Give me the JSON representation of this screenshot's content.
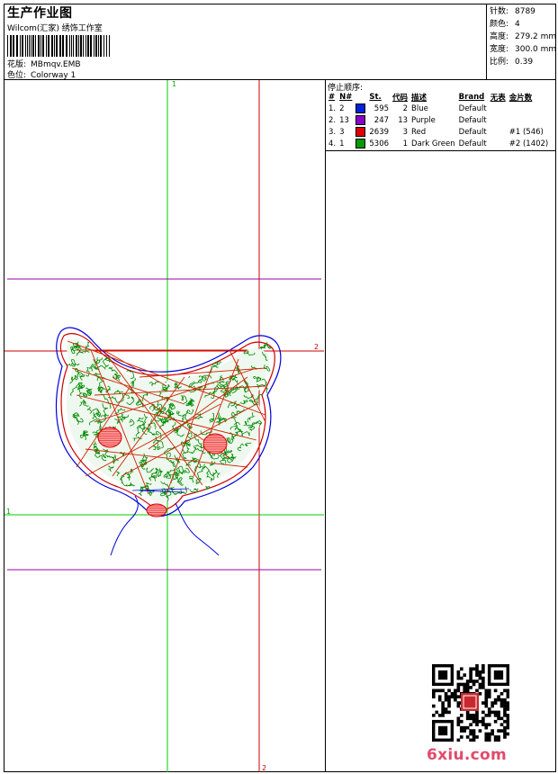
{
  "header": {
    "title": "生产作业图",
    "subtitle": "Wilcom(汇家) 绣饰工作室",
    "design_label": "花版:",
    "design_value": "MBmqv.EMB",
    "colorway_label": "色位:",
    "colorway_value": "Colorway 1"
  },
  "stats": [
    {
      "label": "针数:",
      "value": "8789"
    },
    {
      "label": "颜色:",
      "value": "4"
    },
    {
      "label": "高度:",
      "value": "279.2 mm"
    },
    {
      "label": "宽度:",
      "value": "300.0 mm"
    },
    {
      "label": "比例:",
      "value": "0.39"
    }
  ],
  "stop_sequence": {
    "title": "停止顺序:",
    "columns": [
      "#",
      "N#",
      "St.",
      "代码",
      "描述",
      "Brand",
      "无表",
      "金片数"
    ],
    "rows": [
      {
        "index": "1.",
        "n": "2",
        "color": "#0022dd",
        "stitches": "595",
        "code": "2",
        "desc": "Blue",
        "brand": "Default",
        "extra": "",
        "sequin": ""
      },
      {
        "index": "2.",
        "n": "13",
        "color": "#8a00c8",
        "stitches": "247",
        "code": "13",
        "desc": "Purple",
        "brand": "Default",
        "extra": "",
        "sequin": ""
      },
      {
        "index": "3.",
        "n": "3",
        "color": "#e00000",
        "stitches": "2639",
        "code": "3",
        "desc": "Red",
        "brand": "Default",
        "extra": "",
        "sequin": "#1 (546)"
      },
      {
        "index": "4.",
        "n": "1",
        "color": "#009900",
        "stitches": "5306",
        "code": "1",
        "desc": "Dark Green",
        "brand": "Default",
        "extra": "",
        "sequin": "#2 (1402)"
      }
    ]
  },
  "canvas": {
    "markers": {
      "top": "1",
      "right": "2",
      "left": "1",
      "bottom": "2"
    },
    "colors": {
      "green": "#00cc00",
      "red": "#cc0000",
      "purple": "#9900aa",
      "blue": "#0000dd",
      "stitch_green": "#008800",
      "stitch_red": "#cc2200"
    }
  },
  "watermark": {
    "text": "6xiu.com",
    "color": "#e24a6b"
  }
}
